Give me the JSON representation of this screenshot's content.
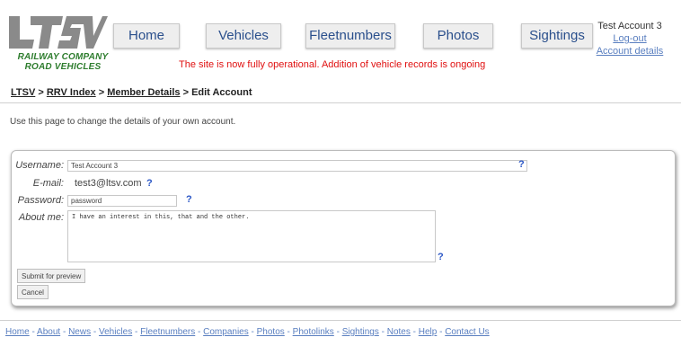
{
  "logo": {
    "text": "LTSV",
    "line1": "RAILWAY COMPANY",
    "line2": "ROAD VEHICLES"
  },
  "nav": [
    {
      "label": "Home"
    },
    {
      "label": "Vehicles"
    },
    {
      "label": "Fleetnumbers"
    },
    {
      "label": "Photos"
    },
    {
      "label": "Sightings"
    }
  ],
  "notice": "The site is now fully operational. Addition of vehicle records is ongoing",
  "account": {
    "name": "Test Account 3",
    "logout": "Log-out",
    "details": "Account details"
  },
  "breadcrumb": {
    "ltsv": "LTSV",
    "sep": " > ",
    "rrv": "RRV Index",
    "member": "Member Details",
    "current": "Edit Account"
  },
  "intro": "Use this page to change the details of your own account.",
  "form": {
    "username_label": "Username:",
    "username_value": "Test Account 3",
    "email_label": "E-mail:",
    "email_value": "test3@ltsv.com",
    "password_label": "Password:",
    "password_value": "password",
    "about_label": "About me:",
    "about_value": "I have an interest in this, that and the other.",
    "help": "?",
    "submit_label": "Submit for preview",
    "cancel_label": "Cancel"
  },
  "footer": {
    "links": [
      "Home",
      "About",
      "News",
      "Vehicles",
      "Fleetnumbers",
      "Companies",
      "Photos",
      "Photolinks",
      "Sightings",
      "Notes",
      "Help",
      "Contact Us"
    ],
    "sep": " - "
  },
  "colors": {
    "link": "#5a7fc0",
    "notice": "#e01010",
    "logo_grey": "#8a8a8a",
    "logo_green": "#2e7d2e",
    "help": "#2a56c6"
  }
}
